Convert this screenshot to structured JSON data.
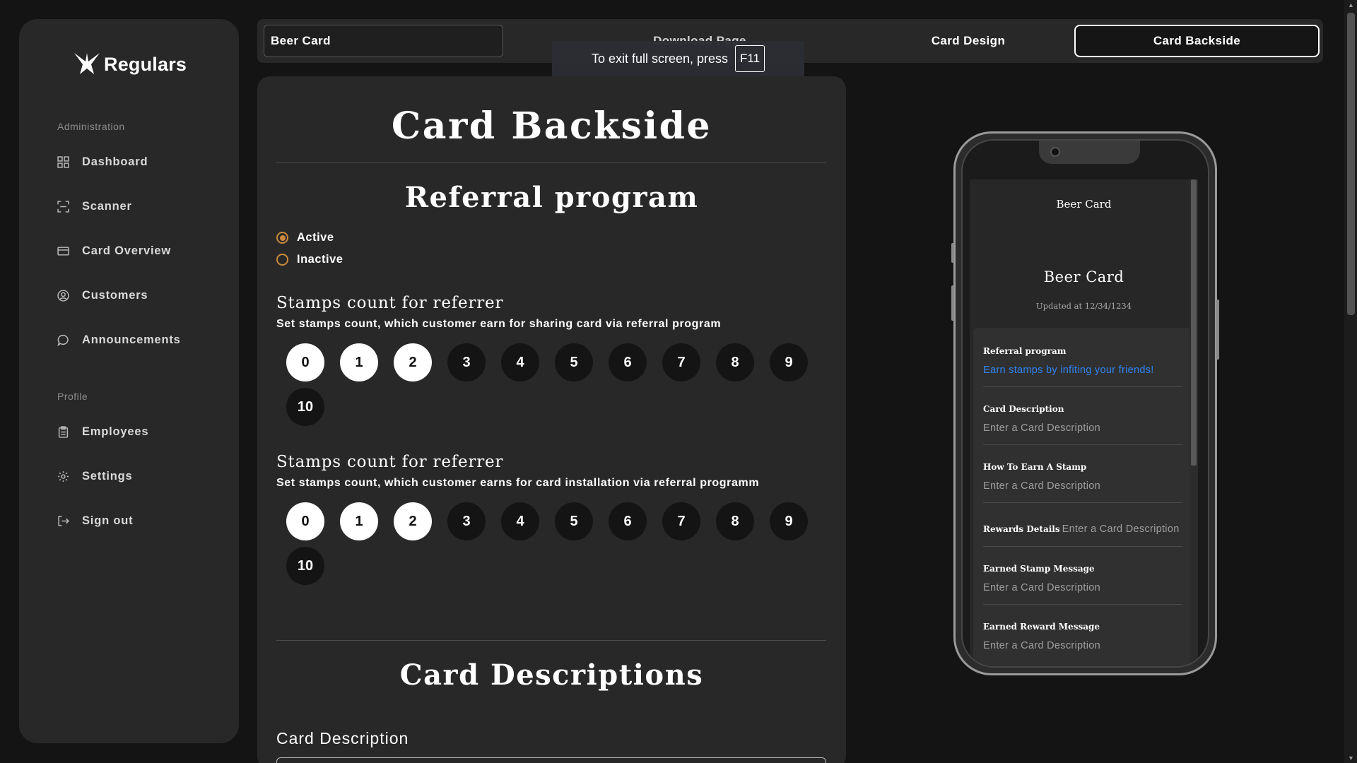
{
  "brand": {
    "name": "Regulars"
  },
  "sidebar": {
    "sections": [
      {
        "title": "Administration"
      },
      {
        "title": "Profile"
      }
    ],
    "items": [
      {
        "label": "Dashboard",
        "icon": "grid-icon"
      },
      {
        "label": "Scanner",
        "icon": "scan-icon"
      },
      {
        "label": "Card Overview",
        "icon": "card-icon"
      },
      {
        "label": "Customers",
        "icon": "user-circle-icon"
      },
      {
        "label": "Announcements",
        "icon": "chat-bubble-icon"
      },
      {
        "label": "Employees",
        "icon": "clipboard-icon"
      },
      {
        "label": "Settings",
        "icon": "gear-icon"
      },
      {
        "label": "Sign out",
        "icon": "sign-out-icon"
      }
    ]
  },
  "topbar": {
    "card_name_value": "Beer Card",
    "tabs": [
      {
        "label": "Download Page"
      },
      {
        "label": "Card Design"
      },
      {
        "label": "Card Backside",
        "active": true
      }
    ]
  },
  "fullscreen_toast": {
    "text": "To exit full screen, press",
    "key": "F11"
  },
  "main": {
    "title": "Card Backside",
    "referral": {
      "title": "Referral program",
      "options": [
        {
          "label": "Active",
          "checked": true
        },
        {
          "label": "Inactive",
          "checked": false
        }
      ],
      "groups": [
        {
          "title": "Stamps count for referrer",
          "description": "Set stamps count, which customer earn for sharing card via referral program",
          "values": [
            "0",
            "1",
            "2",
            "3",
            "4",
            "5",
            "6",
            "7",
            "8",
            "9",
            "10"
          ],
          "selected": [
            "0",
            "1",
            "2"
          ]
        },
        {
          "title": "Stamps count for referrer",
          "description": "Set stamps count, which customer earns for card installation via referral programm",
          "values": [
            "0",
            "1",
            "2",
            "3",
            "4",
            "5",
            "6",
            "7",
            "8",
            "9",
            "10"
          ],
          "selected": [
            "0",
            "1",
            "2"
          ]
        }
      ]
    },
    "descriptions": {
      "title": "Card Descriptions",
      "field_label": "Card Description"
    }
  },
  "phone": {
    "header": "Beer Card",
    "card_name": "Beer Card",
    "updated": "Updated at 12/34/1234",
    "fields": [
      {
        "label": "Referral program",
        "value": "Earn stamps by infiting your friends!"
      },
      {
        "label": "Card Description",
        "value": "Enter a Card Description"
      },
      {
        "label": "How To Earn A Stamp",
        "value": "Enter a Card Description"
      },
      {
        "label": "Rewards Details",
        "value": "Enter a Card Description"
      },
      {
        "label": "Earned Stamp Message",
        "value": "Enter a Card Description"
      },
      {
        "label": "Earned Reward Message",
        "value": "Enter a Card Description"
      }
    ]
  },
  "colors": {
    "background": "#141414",
    "panel": "#282828",
    "radio_accent": "#c8893d",
    "link": "#2f86f5"
  }
}
